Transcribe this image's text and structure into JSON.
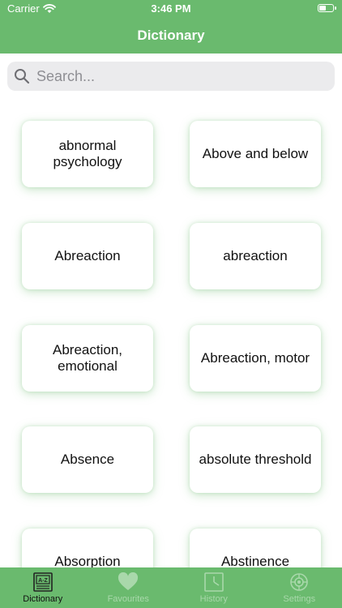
{
  "status_bar": {
    "carrier": "Carrier",
    "time": "3:46 PM"
  },
  "nav": {
    "title": "Dictionary"
  },
  "search": {
    "placeholder": "Search..."
  },
  "terms": [
    "abnormal psychology",
    "Above and below",
    "Abreaction",
    "abreaction",
    "Abreaction, emotional",
    "Abreaction, motor",
    "Absence",
    "absolute threshold",
    "Absorption",
    "Abstinence"
  ],
  "tabs": [
    {
      "label": "Dictionary",
      "icon": "dictionary-icon",
      "active": true
    },
    {
      "label": "Favourites",
      "icon": "heart-icon",
      "active": false
    },
    {
      "label": "History",
      "icon": "clock-icon",
      "active": false
    },
    {
      "label": "Settings",
      "icon": "gear-icon",
      "active": false
    }
  ],
  "colors": {
    "accent": "#6aba6e",
    "search_bg": "#ebebed",
    "inactive_tab": "#a9d8ab"
  }
}
